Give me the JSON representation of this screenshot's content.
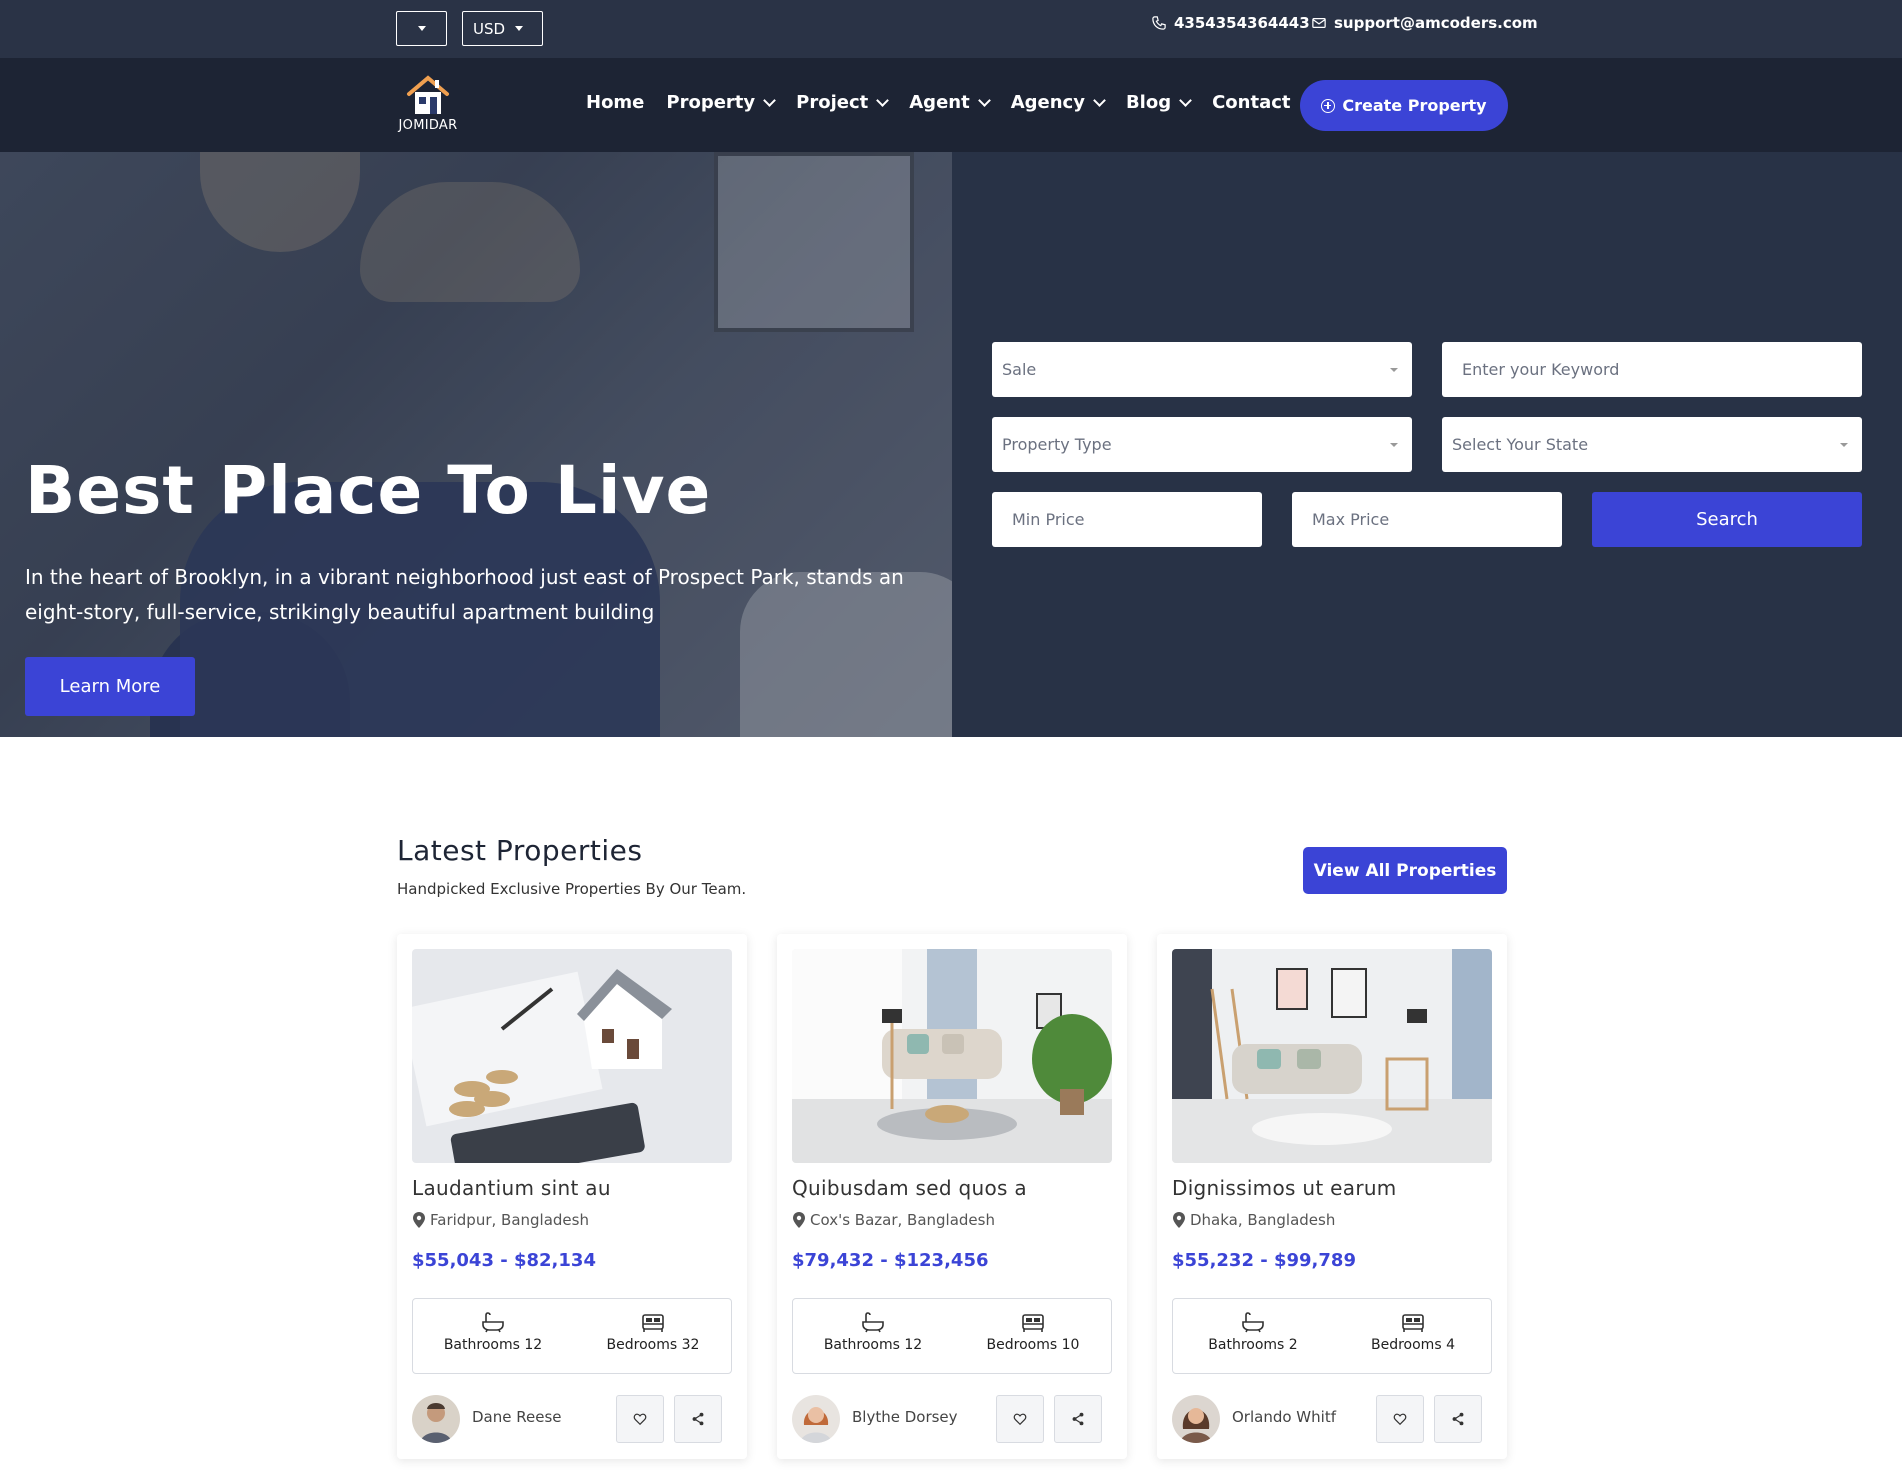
{
  "topbar": {
    "language_select": "",
    "currency_select": "USD",
    "phone": "4354354364443",
    "email": "support@amcoders.com"
  },
  "nav": {
    "logo_text": "JOMIDAR",
    "items": [
      "Home",
      "Property",
      "Project",
      "Agent",
      "Agency",
      "Blog",
      "Contact"
    ],
    "create_label": "Create Property"
  },
  "hero": {
    "title": "Best Place To Live",
    "text": "In the heart of Brooklyn, in a vibrant neighborhood just east of Prospect Park, stands an eight-story, full-service, strikingly beautiful apartment building",
    "learn_more": "Learn More"
  },
  "search": {
    "sale": "Sale",
    "keyword_placeholder": "Enter your Keyword",
    "property_type": "Property Type",
    "state": "Select Your State",
    "min_price": "Min Price",
    "max_price": "Max Price",
    "search_label": "Search"
  },
  "latest": {
    "title": "Latest Properties",
    "subtitle": "Handpicked Exclusive Properties By Our Team.",
    "view_all": "View All Properties",
    "cards": [
      {
        "title": "Laudantium sint au",
        "location": "Faridpur, Bangladesh",
        "price": "$55,043 - $82,134",
        "bathrooms": "Bathrooms 12",
        "bedrooms": "Bedrooms 32",
        "agent": "Dane Reese"
      },
      {
        "title": "Quibusdam sed quos a",
        "location": "Cox's Bazar, Bangladesh",
        "price": "$79,432 - $123,456",
        "bathrooms": "Bathrooms 12",
        "bedrooms": "Bedrooms 10",
        "agent": "Blythe Dorsey"
      },
      {
        "title": "Dignissimos ut earum",
        "location": "Dhaka, Bangladesh",
        "price": "$55,232 - $99,789",
        "bathrooms": "Bathrooms 2",
        "bedrooms": "Bedrooms 4",
        "agent": "Orlando Whitf"
      }
    ]
  },
  "colors": {
    "accent": "#3b44d6",
    "topbar": "#2a3346",
    "navbar": "#1d2434",
    "search_panel": "#283246"
  }
}
